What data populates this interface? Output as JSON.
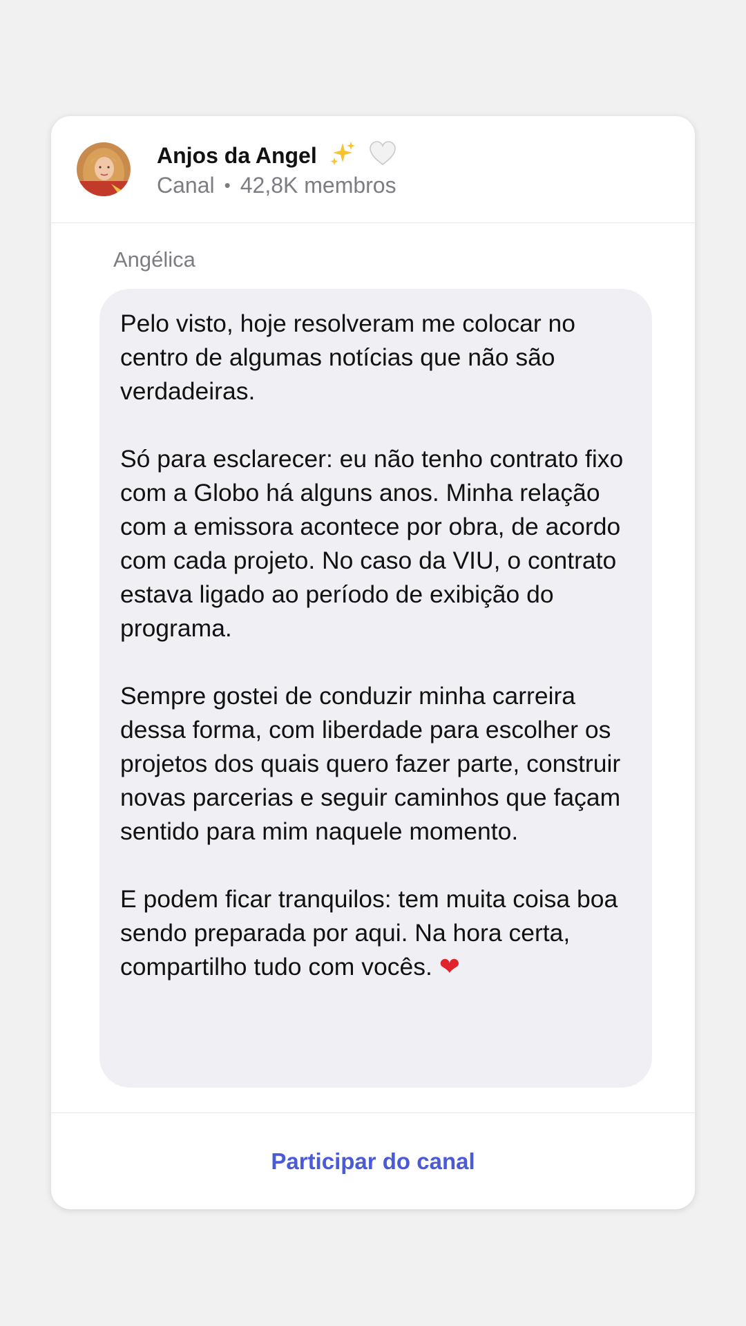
{
  "channel": {
    "name": "Anjos da Angel",
    "type": "Canal",
    "members": "42,8K membros"
  },
  "message": {
    "sender": "Angélica",
    "paragraphs": [
      "Pelo visto, hoje resolveram me colocar no centro de algumas notícias que não são verdadeiras.",
      "Só para esclarecer: eu não tenho contrato fixo com a Globo há alguns anos. Minha relação com a emissora acontece por obra, de acordo com cada projeto. No caso da VIU, o contrato estava ligado ao período de exibição do programa.",
      "Sempre gostei de conduzir minha carreira dessa forma, com liberdade para escolher os projetos dos quais quero fazer parte, construir novas parcerias e seguir caminhos que façam sentido para mim naquele momento.",
      "E podem ficar tranquilos: tem muita coisa boa sendo preparada por aqui. Na hora certa, compartilho tudo com vocês."
    ]
  },
  "footer": {
    "join_label": "Participar do canal"
  },
  "icons": {
    "name_emoji_1": "sparkles-icon",
    "name_emoji_2": "white-heart-icon",
    "message_end_emoji": "red-heart-icon"
  },
  "colors": {
    "background": "#f1f1f2",
    "card": "#ffffff",
    "bubble": "#f0f0f4",
    "secondary_text": "#7c7c83",
    "accent": "#4a5bd7",
    "heart": "#e0242c",
    "sparkles": "#f6c430"
  }
}
